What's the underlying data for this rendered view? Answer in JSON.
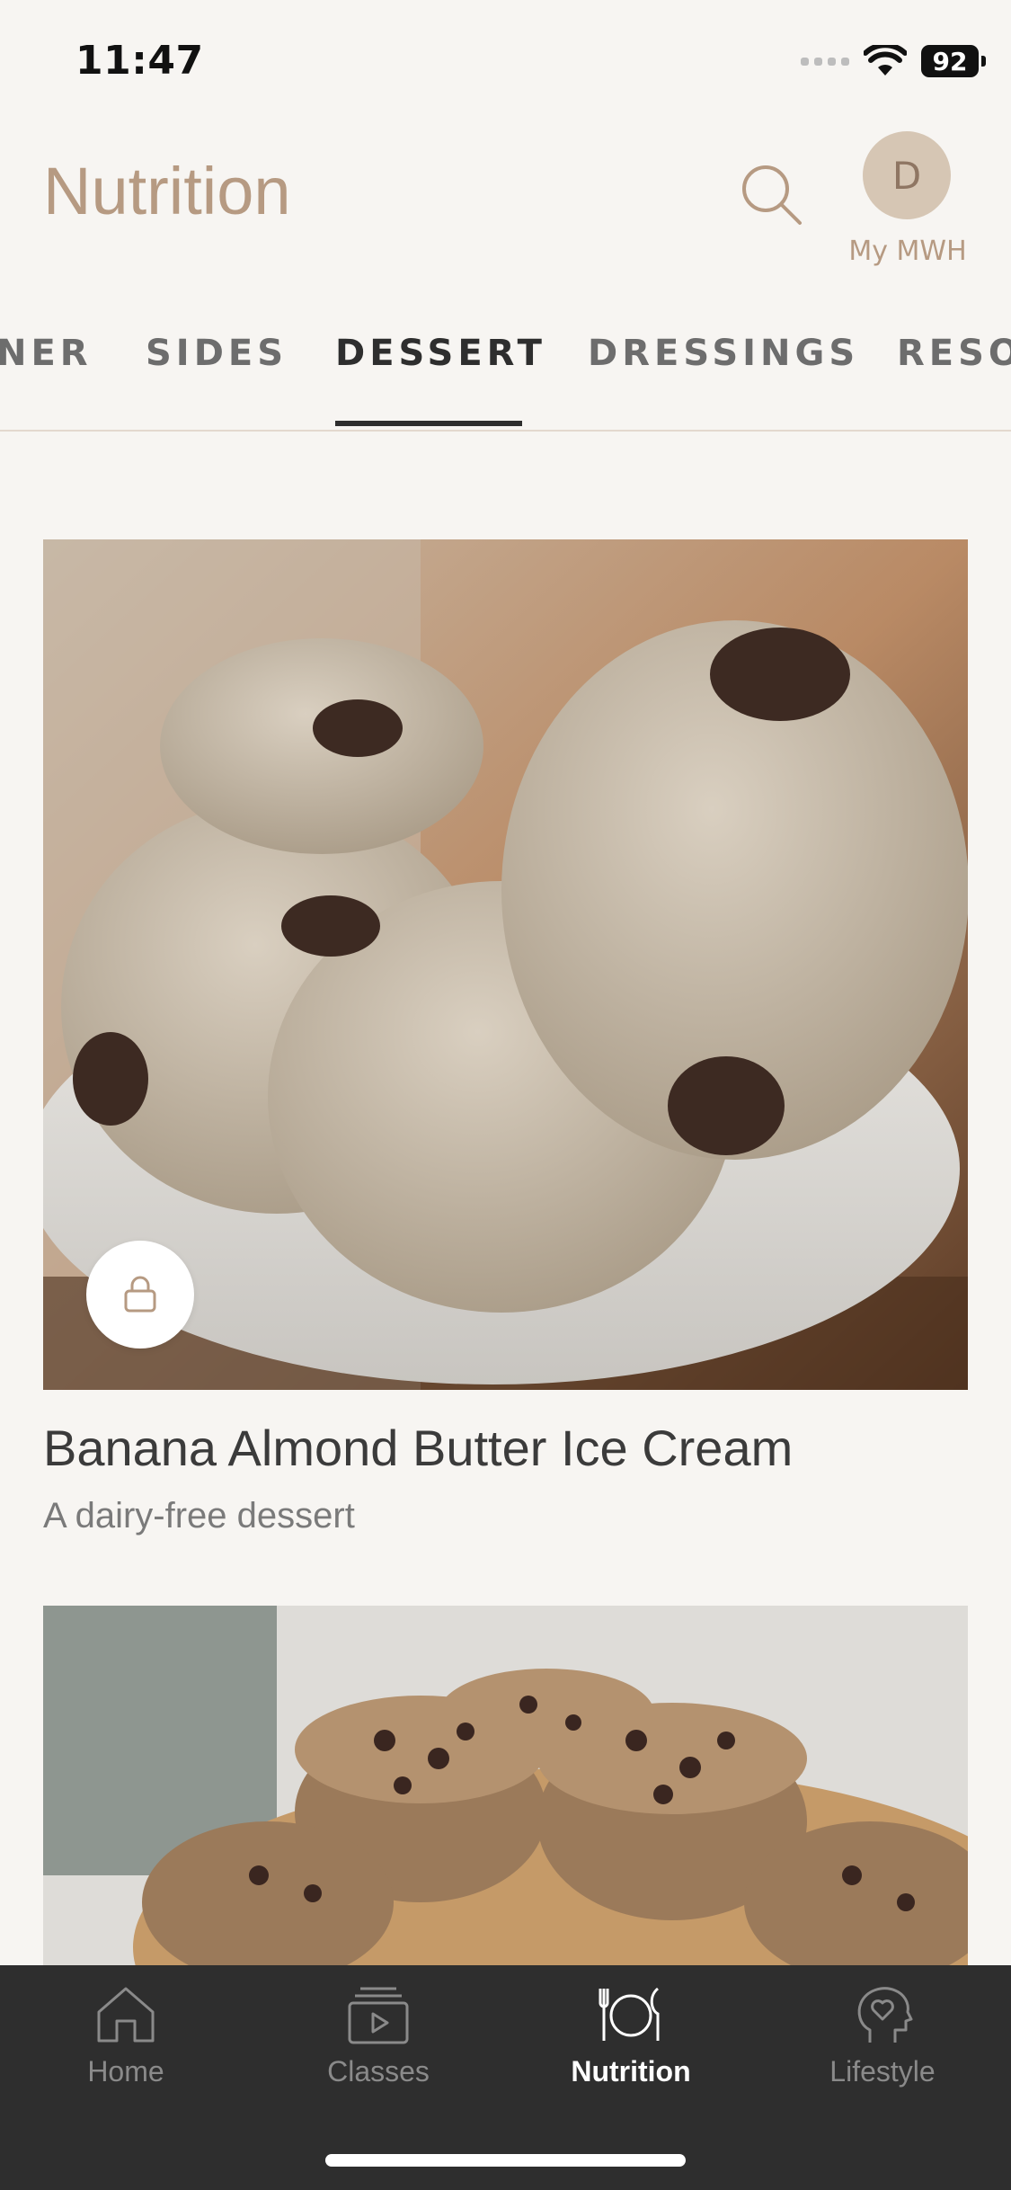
{
  "status_bar": {
    "time": "11:47",
    "battery": "92"
  },
  "header": {
    "title": "Nutrition",
    "avatar_initial": "D",
    "avatar_label": "My MWH"
  },
  "tabs": [
    {
      "label": "NER"
    },
    {
      "label": "SIDES"
    },
    {
      "label": "DESSERT",
      "active": true
    },
    {
      "label": "DRESSINGS"
    },
    {
      "label": "RESO"
    }
  ],
  "recipes": [
    {
      "title": "Banana Almond Butter Ice Cream",
      "subtitle": "A dairy-free dessert",
      "locked": true
    },
    {
      "title": "",
      "subtitle": ""
    }
  ],
  "bottom_nav": [
    {
      "label": "Home",
      "icon": "home-icon"
    },
    {
      "label": "Classes",
      "icon": "classes-icon"
    },
    {
      "label": "Nutrition",
      "icon": "plate-icon",
      "active": true
    },
    {
      "label": "Lifestyle",
      "icon": "head-heart-icon"
    }
  ],
  "colors": {
    "accent": "#b69a82",
    "nav_bg": "#2e2e2e",
    "background": "#f7f5f2"
  }
}
